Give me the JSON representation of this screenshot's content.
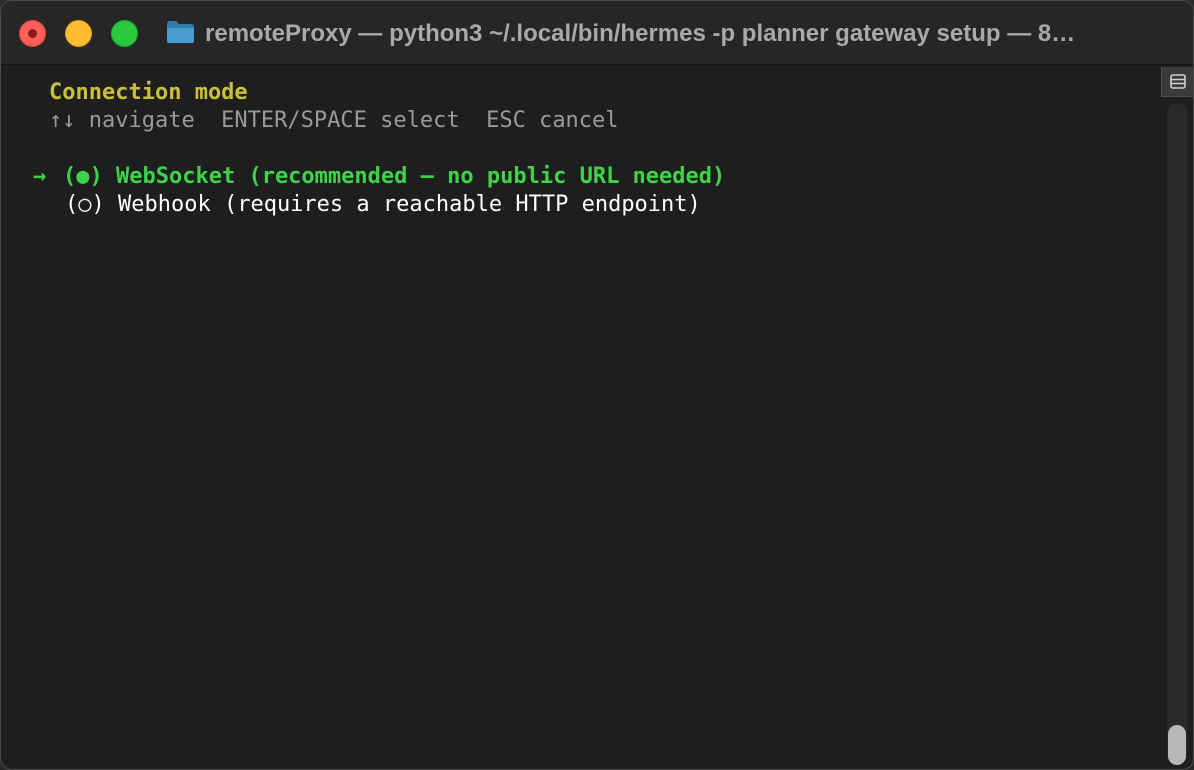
{
  "window": {
    "title": "remoteProxy — python3 ~/.local/bin/hermes -p planner gateway setup — 8…"
  },
  "terminal": {
    "header": "Connection mode",
    "hints": "↑↓ navigate  ENTER/SPACE select  ESC cancel",
    "cursor_glyph": "→",
    "options": [
      {
        "marker": "(●)",
        "label": "WebSocket (recommended — no public URL needed)",
        "selected": true
      },
      {
        "marker": "(○)",
        "label": "Webhook (requires a reachable HTTP endpoint)",
        "selected": false
      }
    ]
  },
  "colors": {
    "header": "#c9c13b",
    "selected": "#3fd34a",
    "hint": "#9a9a9a",
    "background": "#1e1e1e"
  },
  "icons": {
    "folder": "folder-icon",
    "split": "split-pane-icon"
  }
}
